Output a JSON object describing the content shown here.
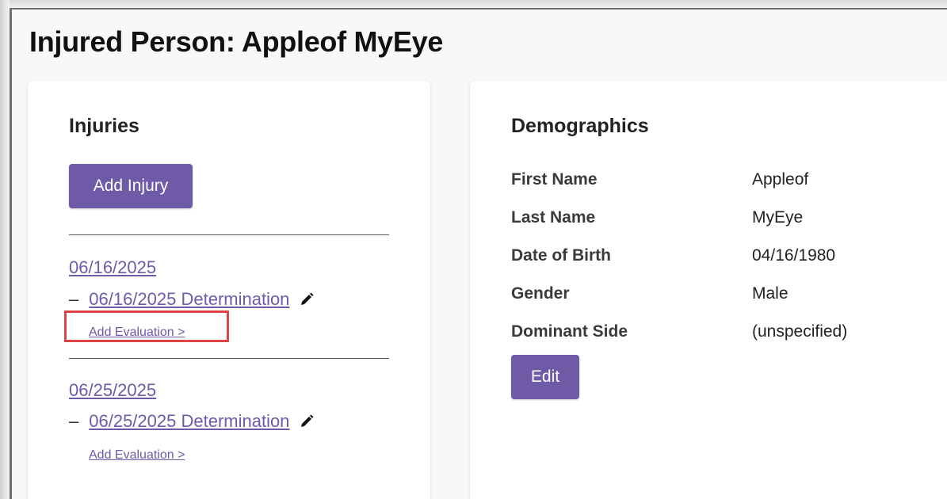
{
  "page": {
    "title": "Injured Person: Appleof MyEye"
  },
  "injuries": {
    "heading": "Injuries",
    "add_button": "Add Injury",
    "items": [
      {
        "date": "06/16/2025",
        "determination": "06/16/2025 Determination",
        "add_evaluation": "Add Evaluation >",
        "highlighted": true
      },
      {
        "date": "06/25/2025",
        "determination": "06/25/2025 Determination",
        "add_evaluation": "Add Evaluation >",
        "highlighted": false
      }
    ],
    "dash": "–"
  },
  "demographics": {
    "heading": "Demographics",
    "fields": [
      {
        "label": "First Name",
        "value": "Appleof"
      },
      {
        "label": "Last Name",
        "value": "MyEye"
      },
      {
        "label": "Date of Birth",
        "value": "04/16/1980"
      },
      {
        "label": "Gender",
        "value": "Male"
      },
      {
        "label": "Dominant Side",
        "value": "(unspecified)"
      }
    ],
    "edit_button": "Edit"
  },
  "colors": {
    "accent": "#6f5aa8",
    "highlight": "#e04545",
    "background": "#f8f8fa",
    "card": "#ffffff"
  },
  "icons": {
    "edit": "pencil-icon"
  }
}
